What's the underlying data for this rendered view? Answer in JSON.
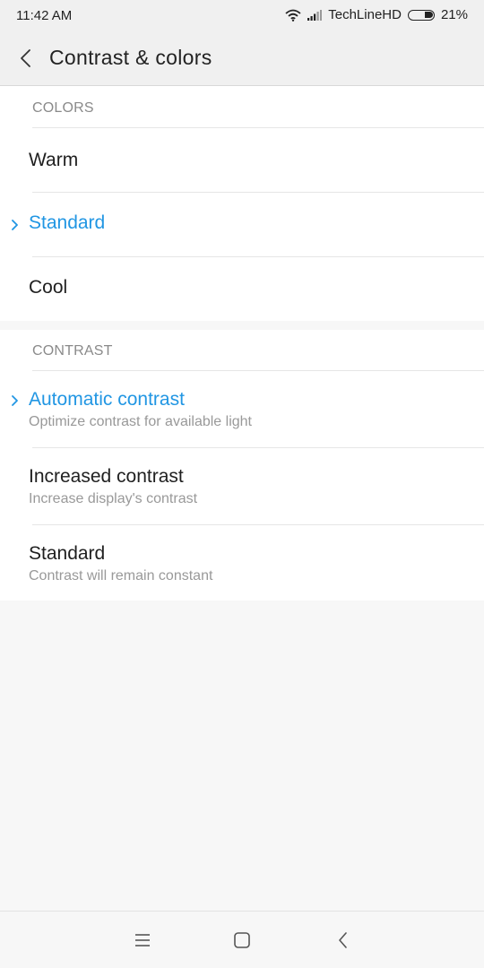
{
  "status_bar": {
    "time": "11:42 AM",
    "carrier": "TechLineHD",
    "battery": "21%",
    "icons": [
      "wifi-icon",
      "signal-icon",
      "battery-icon"
    ]
  },
  "header": {
    "title": "Contrast & colors",
    "back_icon": "chevron-left-icon"
  },
  "colors_section": {
    "header": "COLORS",
    "items": [
      {
        "label": "Warm",
        "selected": false
      },
      {
        "label": "Standard",
        "selected": true
      },
      {
        "label": "Cool",
        "selected": false
      }
    ]
  },
  "contrast_section": {
    "header": "CONTRAST",
    "items": [
      {
        "label": "Automatic contrast",
        "sub": "Optimize contrast for available light",
        "selected": true
      },
      {
        "label": "Increased contrast",
        "sub": "Increase display's contrast",
        "selected": false
      },
      {
        "label": "Standard",
        "sub": "Contrast will remain constant",
        "selected": false
      }
    ]
  },
  "nav_bar": {
    "icons": [
      "menu-icon",
      "home-icon",
      "back-icon"
    ]
  },
  "colors": {
    "accent": "#2196e3",
    "background": "#f7f7f7",
    "surface": "#ffffff"
  }
}
